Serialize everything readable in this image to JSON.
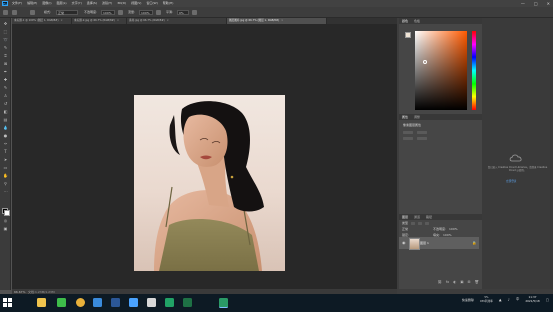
{
  "app": {
    "logo": "Ps",
    "menu": [
      "文件(F)",
      "编辑(E)",
      "图像(I)",
      "图层(L)",
      "文字(Y)",
      "选择(S)",
      "滤镜(T)",
      "3D(D)",
      "视图(V)",
      "窗口(W)",
      "帮助(H)"
    ],
    "window_controls": [
      "—",
      "□",
      "✕"
    ]
  },
  "options": {
    "mode_label": "模式:",
    "mode_value": "正常",
    "opacity_label": "不透明度:",
    "opacity_value": "100%",
    "flow_label": "流量:",
    "flow_value": "100%",
    "smoothing_label": "平滑:",
    "smoothing_value": "0%"
  },
  "tabs": [
    {
      "title": "未标题-1 @ 100% (图层 1, RGB/8#)",
      "close": "×"
    },
    {
      "title": "未标题-2.jpg @ 66.7% (RGB/8#)",
      "close": "×"
    },
    {
      "title": "素材.jpg @ 66.7% (RGB/8#)",
      "close": "×"
    },
    {
      "title": "图层图片.jpg @ 66.7% (图层 1, RGB/8#)",
      "close": "×"
    }
  ],
  "status": {
    "zoom": "66.67%",
    "doc": "文档:1.23M/1.23M"
  },
  "panels": {
    "color_tabs": [
      "颜色",
      "色板"
    ],
    "properties_tabs": [
      "属性",
      "调整"
    ],
    "properties_title": "像素图层属性",
    "layers_tabs": [
      "图层",
      "通道",
      "路径"
    ],
    "filter_label": "类型",
    "blend_mode": "正常",
    "opacity_label": "不透明度:",
    "opacity_value": "100%",
    "lock_label": "锁定:",
    "fill_label": "填充:",
    "fill_value": "100%",
    "layer_name": "图层 1",
    "layer_eye": "◉",
    "layer_lock": "🔒",
    "footer_icons": [
      "⛓",
      "fx",
      "◐",
      "▣",
      "⊞",
      "🗑"
    ],
    "cc_message": "您已进入 Creative Cloud Libraries。请登录 Creative Cloud 以使用。",
    "cc_link": "立即登录"
  },
  "taskbar": {
    "apps": [
      {
        "name": "file-explorer-icon",
        "color": "#f0c44d"
      },
      {
        "name": "wechat-icon",
        "color": "#3ebd4a"
      },
      {
        "name": "chrome-icon",
        "color": "#e8b13b"
      },
      {
        "name": "qq-browser-icon",
        "color": "#3a8bdc"
      },
      {
        "name": "word-icon",
        "color": "#2b5797"
      },
      {
        "name": "browser-icon",
        "color": "#4aa3ff"
      },
      {
        "name": "media-icon",
        "color": "#d8d8d8"
      },
      {
        "name": "sheets-icon",
        "color": "#21a366"
      },
      {
        "name": "excel-icon",
        "color": "#1e7145"
      },
      {
        "name": "photoshop-icon",
        "color": "#2a9a66"
      }
    ],
    "tray_label": "快速删除",
    "cpu": [
      "5%",
      "CPU利用率"
    ],
    "time": "11:37",
    "date": "2021/5/18"
  }
}
